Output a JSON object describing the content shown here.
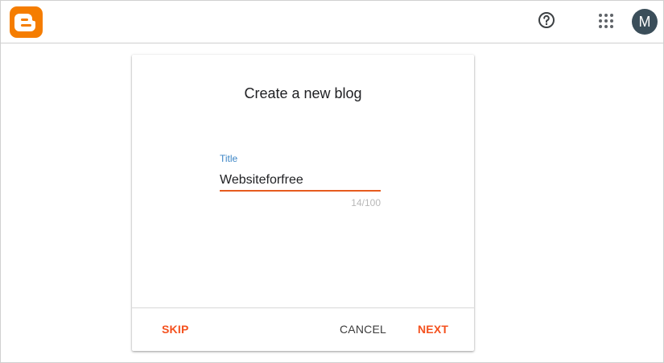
{
  "header": {
    "logo_icon": "blogger-logo-icon",
    "help_icon": "help-circle-icon",
    "apps_icon": "apps-grid-icon",
    "avatar_letter": "M",
    "brand_color": "#f57d00"
  },
  "dialog": {
    "title": "Create a new blog",
    "field": {
      "label": "Title",
      "value": "Websiteforfree",
      "counter": "14/100"
    },
    "buttons": {
      "skip": "SKIP",
      "cancel": "CANCEL",
      "next": "NEXT"
    },
    "accent_color": "#f4511e"
  }
}
